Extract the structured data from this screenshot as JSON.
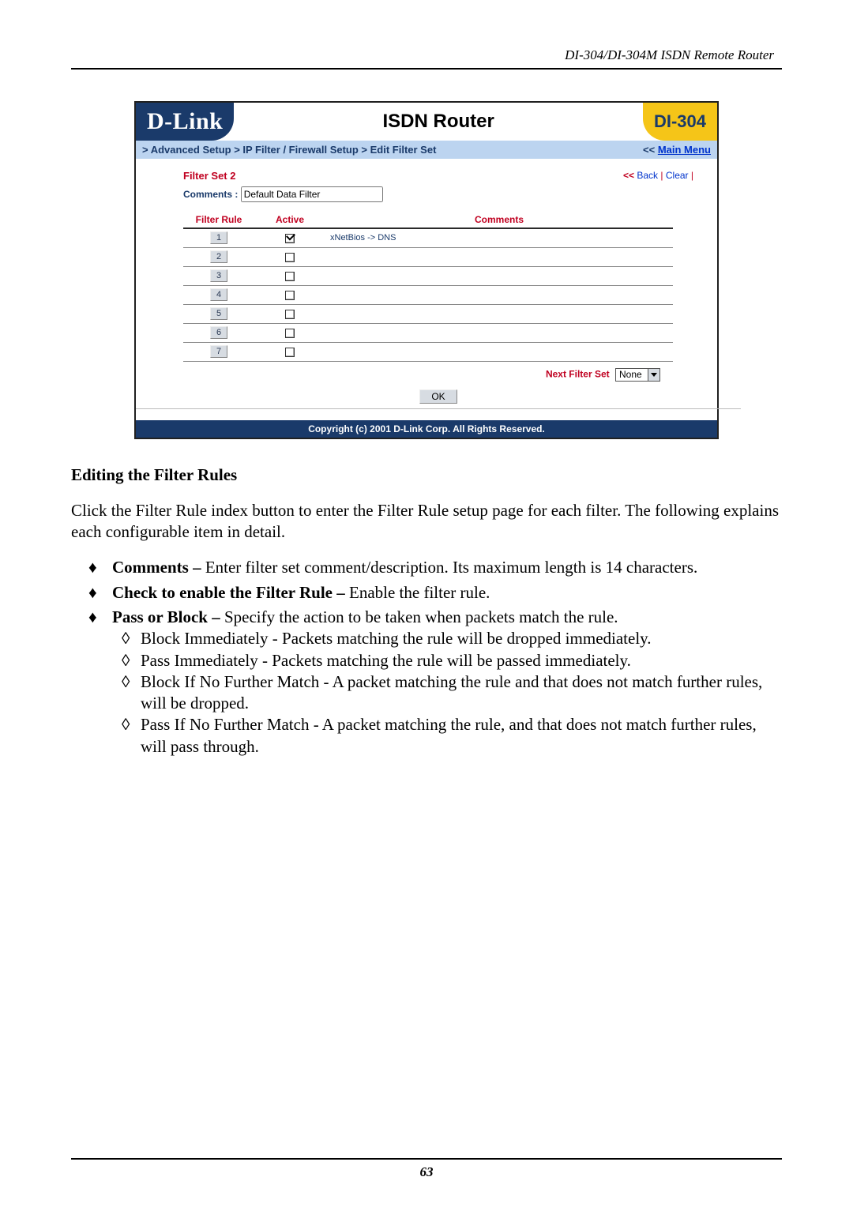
{
  "header": "DI-304/DI-304M ISDN Remote Router",
  "page_number": "63",
  "router_ui": {
    "brand": "D-Link",
    "title": "ISDN Router",
    "model": "DI-304",
    "breadcrumb": " > Advanced Setup > IP Filter / Firewall Setup > Edit Filter Set",
    "main_menu_prefix": "<< ",
    "main_menu_label": "Main Menu",
    "filter_set_label": "Filter Set 2",
    "back_arrows": "<< ",
    "back_label": "Back",
    "separator": " | ",
    "clear_label": "Clear",
    "trail_pipe": " |",
    "comments_label": "Comments :",
    "comments_value": "Default Data Filter",
    "columns": {
      "rule": "Filter Rule",
      "active": "Active",
      "comments": "Comments"
    },
    "rules": [
      {
        "index": "1",
        "active": true,
        "comment": "xNetBios -> DNS"
      },
      {
        "index": "2",
        "active": false,
        "comment": ""
      },
      {
        "index": "3",
        "active": false,
        "comment": ""
      },
      {
        "index": "4",
        "active": false,
        "comment": ""
      },
      {
        "index": "5",
        "active": false,
        "comment": ""
      },
      {
        "index": "6",
        "active": false,
        "comment": ""
      },
      {
        "index": "7",
        "active": false,
        "comment": ""
      }
    ],
    "next_filter_set_label": "Next Filter Set",
    "next_filter_set_value": "None",
    "ok_label": "OK",
    "copyright": "Copyright (c) 2001 D-Link Corp. All Rights Reserved."
  },
  "doc": {
    "section_title": "Editing the Filter Rules",
    "intro": "Click the Filter Rule index button to enter the Filter Rule setup page for each filter. The following explains each configurable item in detail.",
    "items": [
      {
        "label": "Comments –",
        "text": " Enter filter set comment/description. Its maximum length is 14 characters."
      },
      {
        "label": "Check to enable the Filter Rule –",
        "text": " Enable the filter rule."
      },
      {
        "label": "Pass or Block –",
        "text": " Specify the action to be taken when packets match the rule.",
        "sub": [
          " Block Immediately - Packets matching the rule will be dropped immediately.",
          " Pass Immediately - Packets matching the rule will be passed immediately.",
          " Block If No Further Match - A packet matching the rule and that does not match further rules, will be dropped.",
          " Pass If No Further Match - A packet matching the rule, and that does not match further rules, will pass through."
        ]
      }
    ]
  }
}
